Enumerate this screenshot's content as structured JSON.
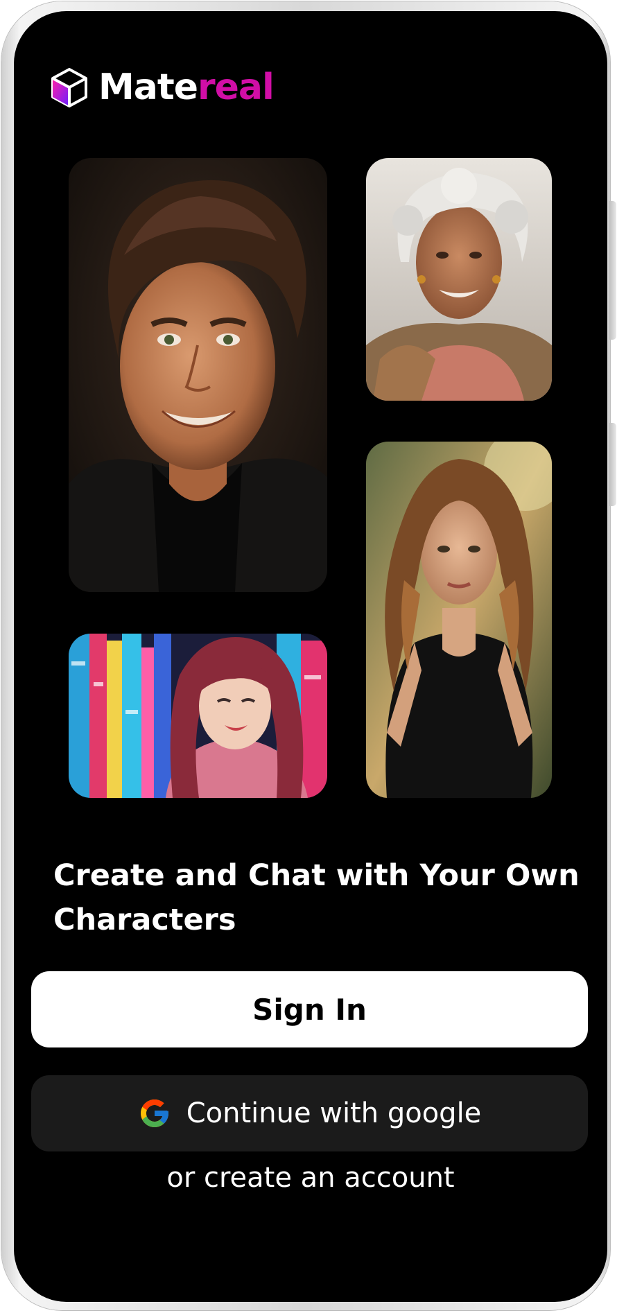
{
  "app": {
    "logo_part1": "Mate",
    "logo_part2": "real",
    "logo_icon": "cube-icon",
    "brand_color": "#d10ea6"
  },
  "gallery": [
    {
      "alt": "Smiling young man with curly brown hair"
    },
    {
      "alt": "Smiling elderly woman with curly gray hair"
    },
    {
      "alt": "Young woman with long wavy hair in sunlight"
    },
    {
      "alt": "Smiling woman with red hair in neon city street"
    }
  ],
  "headline": "Create and Chat with Your Own Characters",
  "actions": {
    "sign_in": "Sign In",
    "google": "Continue with google",
    "google_icon": "google-icon",
    "create_account": "or create an account"
  }
}
